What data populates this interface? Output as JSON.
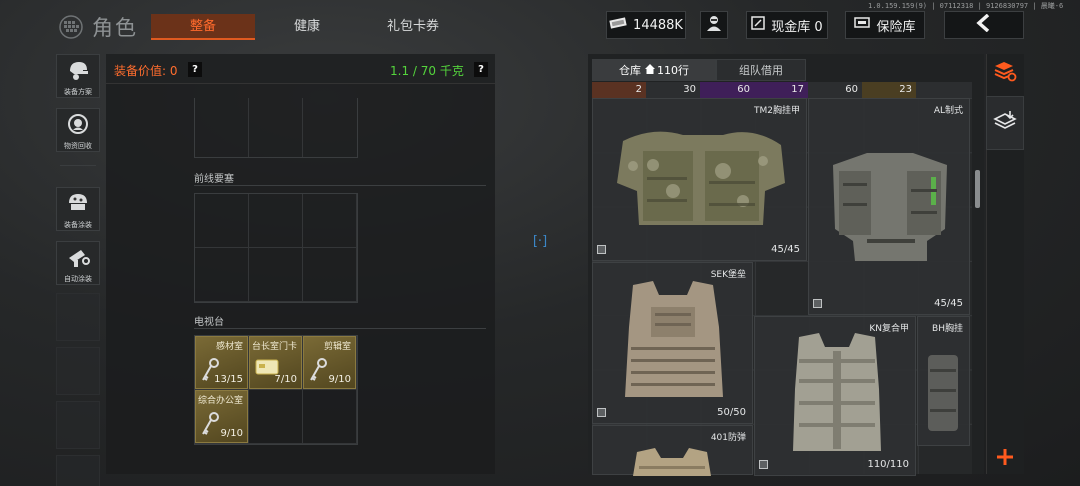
{
  "version": "1.0.159.159(9) | 07112318 | 9126830797 | 晨曦-6",
  "title": "角色",
  "tabs": {
    "equip": "整备",
    "health": "健康",
    "gift": "礼包卡券"
  },
  "topbar": {
    "money": "14488K",
    "cash_vault": "现金库 0",
    "safe_vault": "保险库"
  },
  "sidebar": {
    "gear_plan": "装备方案",
    "recycle": "物资回收",
    "gear_paint": "装备涂装",
    "auto_paint": "自动涂装"
  },
  "equip_panel": {
    "value_label": "装备价值: 0",
    "help": "?",
    "weight": "1.1 / 70 千克",
    "section_frontline": "前线要塞",
    "section_tv": "电视台",
    "keys": [
      {
        "name": "感材室",
        "count": "13/15"
      },
      {
        "name": "台长室门卡",
        "count": "7/10"
      },
      {
        "name": "剪辑室",
        "count": "9/10"
      },
      {
        "name": "综合办公室",
        "count": "9/10"
      }
    ]
  },
  "center_marker": "[·]",
  "warehouse": {
    "tab_store": "仓库",
    "store_rows": "110行",
    "tab_team": "组队借用",
    "strip_values": [
      "2",
      "30",
      "60",
      "17",
      "60",
      "23"
    ],
    "items": [
      {
        "name": "TM2胸挂甲",
        "count": "45/45"
      },
      {
        "name": "AL制式",
        "count": "45/45"
      },
      {
        "name": "SEK堡垒",
        "count": "50/50"
      },
      {
        "name": "KN复合甲",
        "count": "110/110"
      },
      {
        "name": "BH胸挂",
        "count": ""
      },
      {
        "name": "401防弹",
        "count": ""
      }
    ]
  },
  "colors": {
    "accent": "#ff6a2c",
    "weight_green": "#54d43c",
    "key_gold": "#7a6a36"
  }
}
